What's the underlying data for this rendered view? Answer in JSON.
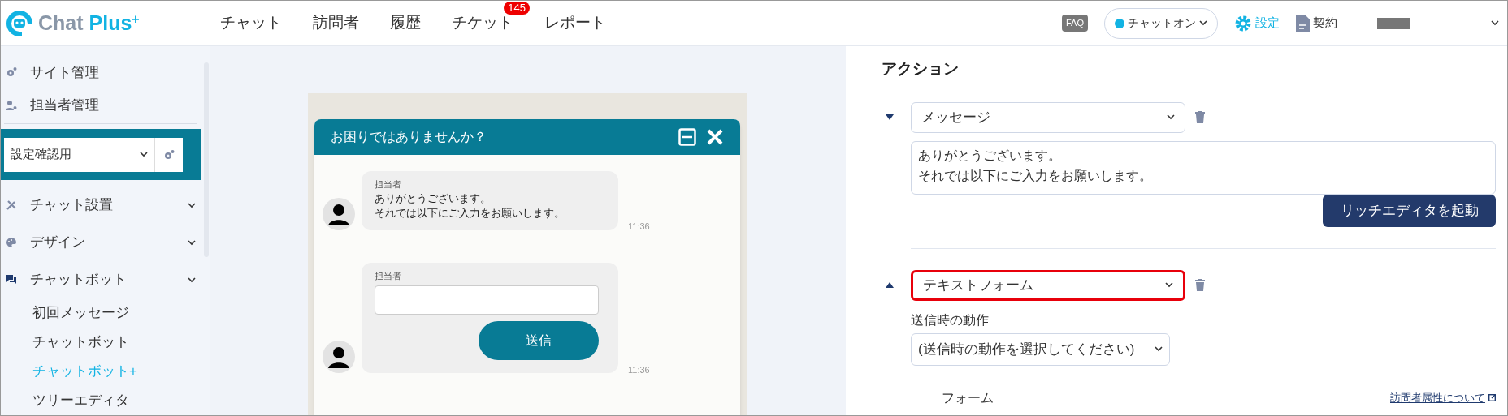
{
  "header": {
    "logo": {
      "name": "Chat Plus",
      "mark": "+"
    },
    "nav": [
      {
        "label": "チャット"
      },
      {
        "label": "訪問者"
      },
      {
        "label": "履歴"
      },
      {
        "label": "チケット",
        "badge": "145"
      },
      {
        "label": "レポート"
      }
    ],
    "faq": "FAQ",
    "status": {
      "label": "チャットオン",
      "on": true
    },
    "settings": "設定",
    "contract": "契約"
  },
  "sidebar": {
    "top_items": [
      {
        "label": "サイト管理"
      },
      {
        "label": "担当者管理"
      }
    ],
    "site_select": {
      "value": "設定確認用"
    },
    "sections": [
      {
        "label": "チャット設置"
      },
      {
        "label": "デザイン"
      },
      {
        "label": "チャットボット",
        "children": [
          {
            "label": "初回メッセージ",
            "selected": false
          },
          {
            "label": "チャットボット",
            "selected": false
          },
          {
            "label": "チャットボット+",
            "selected": true
          },
          {
            "label": "ツリーエディタ",
            "selected": false
          }
        ]
      }
    ]
  },
  "preview": {
    "title": "お困りではありませんか？",
    "messages": [
      {
        "kind": "text",
        "sender": "担当者",
        "lines": [
          "ありがとうございます。",
          "それでは以下にご入力をお願いします。"
        ],
        "time": "11:36"
      },
      {
        "kind": "form",
        "sender": "担当者",
        "button": "送信",
        "time": "11:36"
      }
    ]
  },
  "actions": {
    "heading": "アクション",
    "items": [
      {
        "kind": "message",
        "expanded": false,
        "type": "メッセージ",
        "highlighted": false,
        "lines": [
          "ありがとうございます。",
          "それでは以下にご入力をお願いします。"
        ],
        "button": "リッチエディタを起動"
      },
      {
        "kind": "text_form",
        "expanded": true,
        "type": "テキストフォーム",
        "highlighted": true,
        "submit_label": "送信時の動作",
        "submit_value": "(送信時の動作を選択してください)",
        "form_label": "フォーム",
        "link": "訪問者属性について"
      }
    ]
  }
}
